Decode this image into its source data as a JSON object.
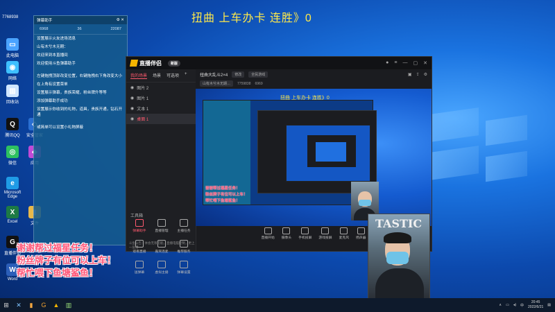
{
  "overlay_title": "扭曲 上车办卡 连胜》0",
  "desktop_icons": [
    {
      "label": "此电脑",
      "color": "#4aa3ff",
      "glyph": "▭",
      "icon": "computer-icon"
    },
    {
      "label": "网络",
      "color": "#3ec0ff",
      "glyph": "◉",
      "icon": "network-icon"
    },
    {
      "label": "回收站",
      "color": "#cfe6ff",
      "glyph": "▥",
      "icon": "recycle-bin-icon"
    },
    {
      "label": "腾讯QQ",
      "color": "#111111",
      "glyph": "Q",
      "icon": "qq-icon"
    },
    {
      "label": "微信",
      "color": "#2ec160",
      "glyph": "◎",
      "icon": "wechat-icon"
    },
    {
      "label": "Microsoft Edge",
      "color": "#1f9be6",
      "glyph": "e",
      "icon": "edge-icon"
    },
    {
      "label": "Excel",
      "color": "#1d7a45",
      "glyph": "X",
      "icon": "excel-icon"
    },
    {
      "label": "直播伴侣",
      "color": "#111111",
      "glyph": "G",
      "icon": "stream-app-icon"
    },
    {
      "label": "Word",
      "color": "#2b5eb8",
      "glyph": "W",
      "icon": "word-icon"
    },
    {
      "label": "文件",
      "color": "#e8b84a",
      "glyph": "▮",
      "icon": "folder-icon"
    },
    {
      "label": "安全管家",
      "color": "#2a6fd1",
      "glyph": "◇",
      "icon": "security-icon"
    },
    {
      "label": "应用",
      "color": "#c14ad6",
      "glyph": "◆",
      "icon": "app-icon"
    }
  ],
  "top_left_id": "7768938",
  "chat": {
    "title": "弹幕助手",
    "stats": [
      "6968",
      "36",
      "22087"
    ],
    "messages": [
      {
        "text": "设置展示火友进场消息",
        "gold": false
      },
      {
        "text": "山有木兮木无期：",
        "gold": true
      },
      {
        "text": "欢迎来到本直播间",
        "gold": false
      },
      {
        "text": "欢迎使用斗鱼弹幕助手",
        "gold": false
      },
      {
        "text": "左键拖拽顶部改变位置，右键拖拽右下角改变大小",
        "gold": false
      },
      {
        "text": "在上角有设置菜单",
        "gold": false
      },
      {
        "text": "设置展示弹幕，贵族荣耀，粉丝牌升等等",
        "gold": false
      },
      {
        "text": "添加弹幕助手成功",
        "gold": false
      },
      {
        "text": "设置展示你收到的礼物，道具，贵族开通，钻石开通",
        "gold": false
      },
      {
        "text": "或简单可以设置小礼物屏蔽",
        "gold": false
      }
    ]
  },
  "red_messages": [
    "谢谢帮过福星任务！",
    "粉丝牌子有位可以上车！",
    "帮忙喂下鱼塘鲨鱼！"
  ],
  "app": {
    "name": "直播伴侣",
    "badge": "新版",
    "tabs": [
      "我的场景",
      "场景",
      "可选项",
      "+"
    ],
    "scenes": [
      "图片 2",
      "图片 1",
      "文本 1",
      "桌面 1"
    ],
    "stream_title": "扭曲大乱斗2×4",
    "edit_label": "修改",
    "category": "全民游戏",
    "anchor": "山有木兮木无期…",
    "room_id": "7759838",
    "fans": "6969",
    "tools_label": "工具箱",
    "tools": [
      "弹幕助手",
      "直播管理",
      "主播任务",
      "观看直播",
      "嘉宾连麦",
      "推荐服务",
      "送弹幕",
      "虚拟主播",
      "弹幕设置"
    ],
    "bottom_tools": [
      "直播开始",
      "摄像头",
      "手机投屏",
      "游戏投屏",
      "麦克风",
      "扬声器"
    ],
    "status_text": "斗鱼公告：体会无限可能，直播电脑控制，更上一层楼"
  },
  "preview": {
    "title": "扭曲 上车办卡 连胜》0",
    "red_messages": [
      "谢谢帮过福星任务！",
      "粉丝牌子有位可以上车！",
      "帮忙喂下鱼塘鲨鱼！"
    ]
  },
  "cam_text": "TASTIC",
  "taskbar": {
    "time": "20:45",
    "date": "2022/6/21",
    "lang": "中"
  }
}
